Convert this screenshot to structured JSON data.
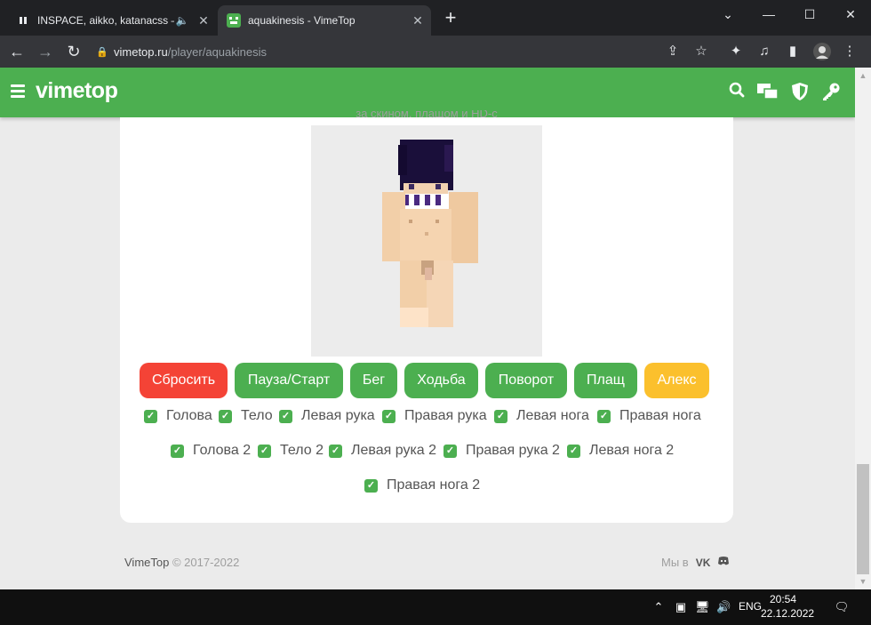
{
  "browser": {
    "tabs": [
      {
        "title": "INSPACE, aikko, katanacss —",
        "playing": true
      },
      {
        "title": "aquakinesis - VimeTop",
        "active": true
      }
    ],
    "window_controls": {
      "minimize": "—",
      "maximize": "☐",
      "close": "✕"
    },
    "url": {
      "domain": "vimetop.ru",
      "path": "/player/aquakinesis"
    }
  },
  "site": {
    "logo": "vimetop",
    "brand_color": "#4caf50"
  },
  "player": {
    "cut_heading": "за скином, плащом и HD-с",
    "buttons": [
      {
        "label": "Сбросить",
        "color": "red"
      },
      {
        "label": "Пауза/Старт",
        "color": "green"
      },
      {
        "label": "Бег",
        "color": "green"
      },
      {
        "label": "Ходьба",
        "color": "green"
      },
      {
        "label": "Поворот",
        "color": "green"
      },
      {
        "label": "Плащ",
        "color": "green"
      },
      {
        "label": "Алекс",
        "color": "amber"
      }
    ],
    "checkboxes_row1": [
      "Голова",
      "Тело",
      "Левая рука",
      "Правая рука",
      "Левая нога",
      "Правая нога"
    ],
    "checkboxes_row2": [
      "Голова 2",
      "Тело 2",
      "Левая рука 2",
      "Правая рука 2",
      "Левая нога 2"
    ],
    "checkboxes_row3": [
      "Правая нога 2"
    ],
    "all_checked": true
  },
  "footer": {
    "brand": "VimeTop",
    "copyright": "© 2017-2022",
    "social_label": "Мы в",
    "social_icons": [
      "vk-icon",
      "discord-icon"
    ]
  },
  "taskbar": {
    "language": "ENG",
    "time": "20:54",
    "date": "22.12.2022"
  },
  "colors": {
    "red": "#f44336",
    "green": "#4caf50",
    "amber": "#fbc02d"
  }
}
